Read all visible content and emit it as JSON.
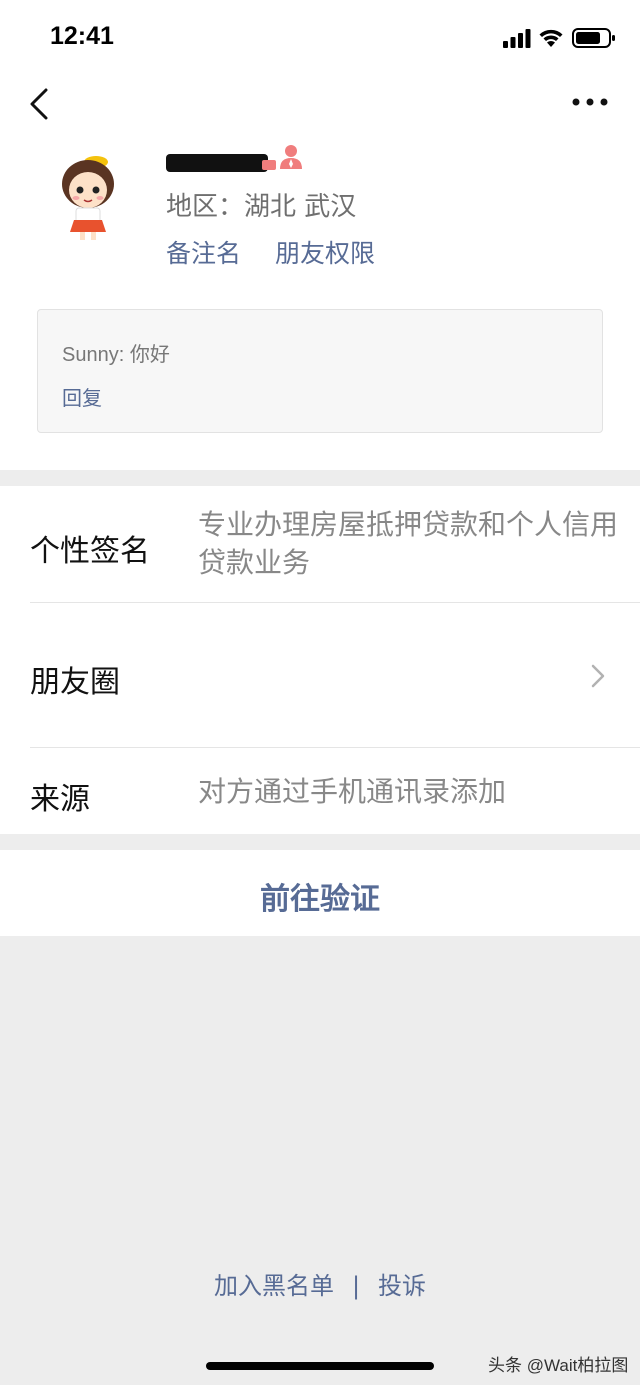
{
  "status_bar": {
    "time": "12:41"
  },
  "profile": {
    "region": "地区：湖北 武汉",
    "links": [
      "备注名",
      "朋友权限"
    ],
    "message": {
      "text": "Sunny: 你好",
      "reply_label": "回复"
    }
  },
  "info": {
    "signature": {
      "label": "个性签名",
      "value": "专业办理房屋抵押贷款和个人信用贷款业务"
    },
    "moments": {
      "label": "朋友圈"
    },
    "source": {
      "label": "来源",
      "value": "对方通过手机通讯录添加"
    }
  },
  "verify": {
    "label": "前往验证"
  },
  "footer": {
    "blacklist_label": "加入黑名单",
    "separator": "|",
    "report_label": "投诉"
  },
  "watermark": "头条 @Wait柏拉图",
  "colors": {
    "link": "#576b95",
    "background": "#ededed"
  }
}
